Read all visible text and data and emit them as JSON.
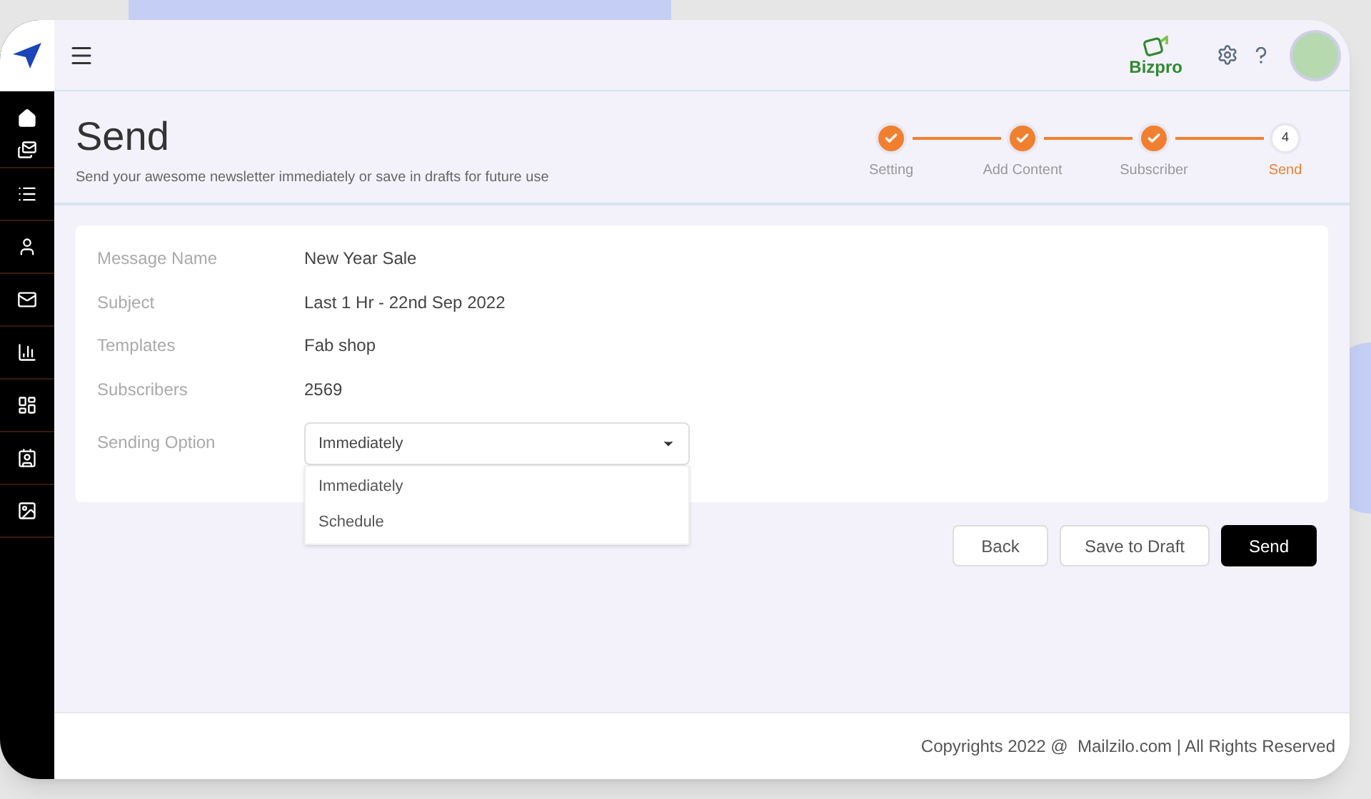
{
  "header": {
    "brand": "Bizpro"
  },
  "page": {
    "title": "Send",
    "subtitle": "Send your awesome newsletter immediately or save in drafts for future use"
  },
  "stepper": [
    {
      "label": "Setting",
      "done": true,
      "selected": false
    },
    {
      "label": "Add Content",
      "done": true,
      "selected": false
    },
    {
      "label": "Subscriber",
      "done": true,
      "selected": false
    },
    {
      "label": "Send",
      "done": false,
      "selected": true,
      "number": "4"
    }
  ],
  "details": [
    {
      "label": "Message Name",
      "value": "New Year Sale"
    },
    {
      "label": "Subject",
      "value": "Last 1 Hr - 22nd Sep 2022"
    },
    {
      "label": "Templates",
      "value": "Fab shop"
    },
    {
      "label": "Subscribers",
      "value": "2569"
    }
  ],
  "sending_option": {
    "label": "Sending Option",
    "value": "Immediately",
    "expanded": true,
    "options": [
      "Immediately",
      "Schedule"
    ]
  },
  "buttons": [
    {
      "label": "Back",
      "kind": "outline"
    },
    {
      "label": "Save to Draft",
      "kind": "outline"
    },
    {
      "label": "Send",
      "kind": "primary"
    }
  ],
  "footer": "Copyrights 2022 @  Mailzilo.com | All Rights Reserved"
}
